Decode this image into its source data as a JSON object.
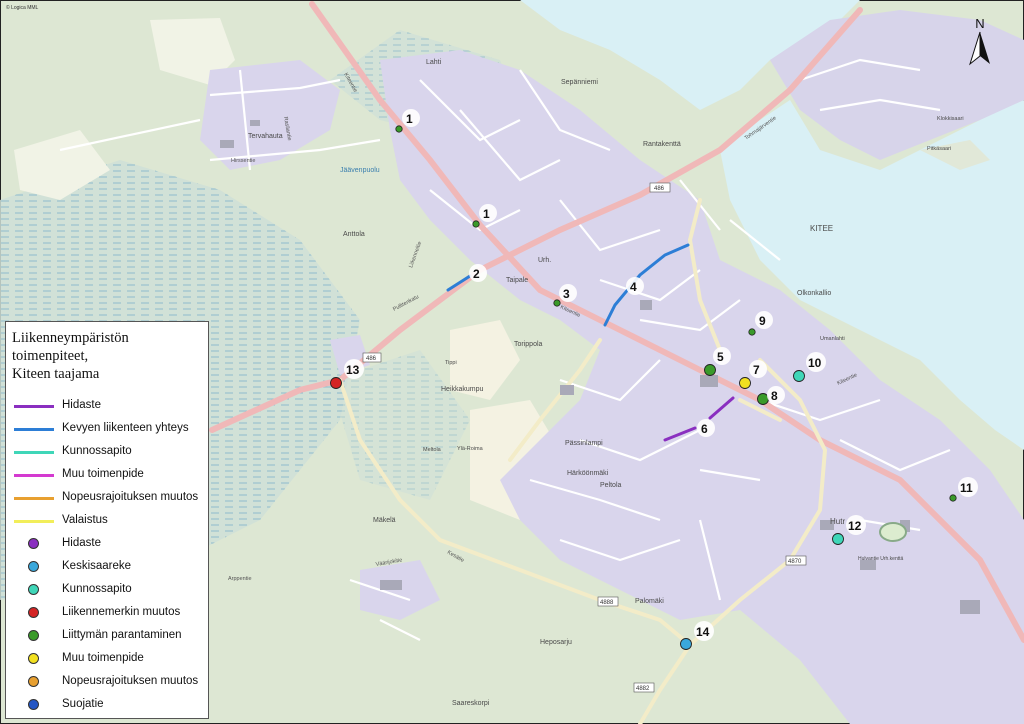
{
  "colors": {
    "hidaste": "#8a2fc0",
    "kevyen_liikenteen_yhteys": "#2d7ed6",
    "kunnossapito": "#3fd6b8",
    "muu_toimenpide_line": "#d43ad0",
    "nopeusrajoituksen_muutos_line": "#e8a030",
    "valaistus": "#f2ee5a",
    "keskisaareke": "#3aa8dc",
    "liikennemerkin_muutos": "#d42424",
    "liittyman_parantaminen": "#3a9a2a",
    "muu_toimenpide_dot": "#f2e020",
    "nopeusrajoituksen_muutos_dot": "#e8a030",
    "suojatie": "#2456c4"
  },
  "legend": {
    "title_lines": [
      "Liikenneympäristön",
      "toimenpiteet,",
      "Kiteen taajama"
    ],
    "line_items": [
      {
        "label": "Hidaste",
        "color": "#8a2fc0"
      },
      {
        "label": "Kevyen liikenteen yhteys",
        "color": "#2d7ed6"
      },
      {
        "label": "Kunnossapito",
        "color": "#3fd6b8"
      },
      {
        "label": "Muu toimenpide",
        "color": "#d43ad0"
      },
      {
        "label": "Nopeusrajoituksen muutos",
        "color": "#e8a030"
      },
      {
        "label": "Valaistus",
        "color": "#f2ee5a"
      }
    ],
    "point_items": [
      {
        "label": "Hidaste",
        "color": "#8a2fc0"
      },
      {
        "label": "Keskisaareke",
        "color": "#3aa8dc"
      },
      {
        "label": "Kunnossapito",
        "color": "#3fd6b8"
      },
      {
        "label": "Liikennemerkin muutos",
        "color": "#d42424"
      },
      {
        "label": "Liittymän parantaminen",
        "color": "#3a9a2a"
      },
      {
        "label": "Muu toimenpide",
        "color": "#f2e020"
      },
      {
        "label": "Nopeusrajoituksen muutos",
        "color": "#e8a030"
      },
      {
        "label": "Suojatie",
        "color": "#2456c4"
      }
    ]
  },
  "north_label": "N",
  "copyright": "© Logica MML",
  "place_labels": {
    "tervahauta": "Tervahauta",
    "anttola": "Anttola",
    "sepanniemi": "Sepänniemi",
    "kitee": "KITEE",
    "olkonkallio": "Olkonkallio",
    "lahti": "Lahti",
    "rantakenttä": "Rantakenttä",
    "umanlahti": "Umanlahti",
    "peltola": "Peltola",
    "palomaki": "Palomäki",
    "heposarju": "Heposarju",
    "saareskorpi": "Saareskorpi",
    "makela": "Mäkelä",
    "torippola": "Torippola",
    "heikkakumpu": "Heikkakumpu",
    "passinlampi": "Pässinlampi",
    "harkoonmaki": "Härköönmäki",
    "hutr": "Hutr",
    "urh": "Urh.",
    "taipale": "Taipale",
    "jarvenpaa": "Jäävenpuolu",
    "klokkisaari": "Klokkisaari",
    "pitkasaari": "Pitkäsaari",
    "tippi": "Tippi",
    "meltola": "Meltola",
    "ylaroima": "Ylä-Roima",
    "urheilukentta": "Hulvantie Urh.kenttä"
  },
  "road_labels": {
    "kiteentie": "Kiteentie",
    "tohmajarventie": "Tohmajärventie",
    "pullitenkatu": "Pullitenkatu",
    "kesatie": "Kesätie",
    "arppentie": "Arppentie",
    "herrastentie": "Hirssentie",
    "rasilantie": "Rasilantie",
    "liikennetie": "Liikenneltie",
    "vaaranjokitie": "Väärijokitie",
    "kiteetie2": "Kiteentie",
    "keskustie": "Kiteentie"
  },
  "road_numbers": [
    "486",
    "486",
    "486",
    "4870",
    "4888",
    "4882"
  ],
  "markers": [
    {
      "number": "1",
      "type": "Liittymän parantaminen",
      "color": "#3a9a2a"
    },
    {
      "number": "1",
      "type": "Liittymän parantaminen",
      "color": "#3a9a2a"
    },
    {
      "number": "2",
      "type": "Kevyen liikenteen yhteys",
      "color": "#2d7ed6"
    },
    {
      "number": "3",
      "type": "Liittymän parantaminen",
      "color": "#3a9a2a"
    },
    {
      "number": "4",
      "type": "Kevyen liikenteen yhteys",
      "color": "#2d7ed6"
    },
    {
      "number": "5",
      "type": "Liittymän parantaminen",
      "color": "#3a9a2a"
    },
    {
      "number": "6",
      "type": "Hidaste",
      "color": "#8a2fc0"
    },
    {
      "number": "7",
      "type": "Muu toimenpide",
      "color": "#f2e020"
    },
    {
      "number": "8",
      "type": "Liittymän parantaminen",
      "color": "#3a9a2a"
    },
    {
      "number": "9",
      "type": "Liittymän parantaminen",
      "color": "#3a9a2a"
    },
    {
      "number": "10",
      "type": "Kunnossapito",
      "color": "#3fd6b8"
    },
    {
      "number": "11",
      "type": "Liittymän parantaminen",
      "color": "#3a9a2a"
    },
    {
      "number": "12",
      "type": "Kunnossapito",
      "color": "#3fd6b8"
    },
    {
      "number": "13",
      "type": "Liikennemerkin muutos",
      "color": "#d42424"
    },
    {
      "number": "14",
      "type": "Keskisaareke",
      "color": "#3aa8dc"
    }
  ]
}
